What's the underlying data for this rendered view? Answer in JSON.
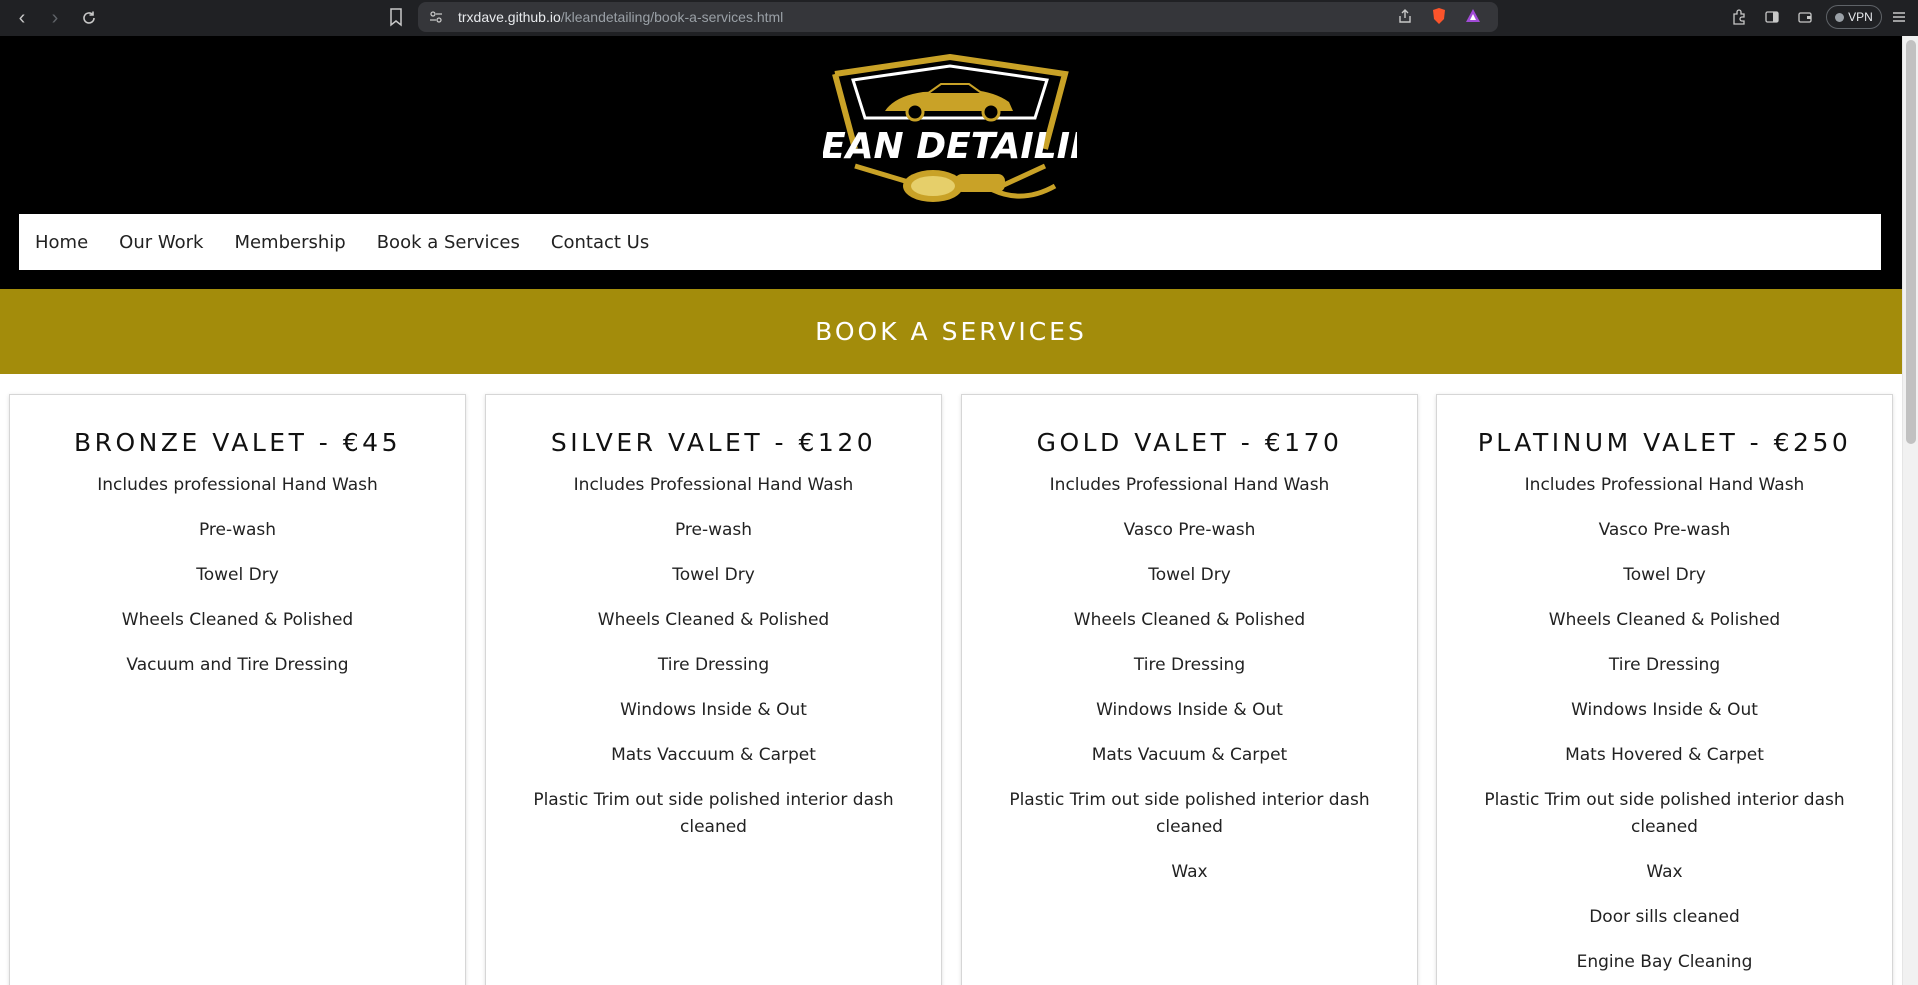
{
  "browser": {
    "url_host": "trxdave.github.io",
    "url_path": "/kleandetailing/book-a-services.html",
    "vpn_label": "VPN"
  },
  "header": {
    "brand": "KLEAN DETAILING"
  },
  "nav": {
    "items": [
      "Home",
      "Our Work",
      "Membership",
      "Book a Services",
      "Contact Us"
    ]
  },
  "banner": {
    "title": "BOOK A SERVICES"
  },
  "packages": [
    {
      "title": "BRONZE VALET - €45",
      "features": [
        "Includes professional Hand Wash",
        "Pre-wash",
        "Towel Dry",
        "Wheels Cleaned & Polished",
        "Vacuum and Tire Dressing"
      ]
    },
    {
      "title": "SILVER VALET - €120",
      "features": [
        "Includes Professional Hand Wash",
        "Pre-wash",
        "Towel Dry",
        "Wheels Cleaned & Polished",
        "Tire Dressing",
        "Windows Inside & Out",
        "Mats Vaccuum & Carpet",
        "Plastic Trim out side polished interior dash cleaned"
      ]
    },
    {
      "title": "GOLD VALET - €170",
      "features": [
        "Includes Professional Hand Wash",
        "Vasco Pre-wash",
        "Towel Dry",
        "Wheels Cleaned & Polished",
        "Tire Dressing",
        "Windows Inside & Out",
        "Mats Vacuum & Carpet",
        "Plastic Trim out side polished interior dash cleaned",
        "Wax"
      ]
    },
    {
      "title": "PLATINUM VALET - €250",
      "features": [
        "Includes Professional Hand Wash",
        "Vasco Pre-wash",
        "Towel Dry",
        "Wheels Cleaned & Polished",
        "Tire Dressing",
        "Windows Inside & Out",
        "Mats Hovered & Carpet",
        "Plastic Trim out side polished interior dash cleaned",
        "Wax",
        "Door sills cleaned",
        "Engine Bay Cleaning"
      ]
    }
  ],
  "colors": {
    "banner_gold": "#a38c0b",
    "logo_gold": "#c9a227"
  }
}
